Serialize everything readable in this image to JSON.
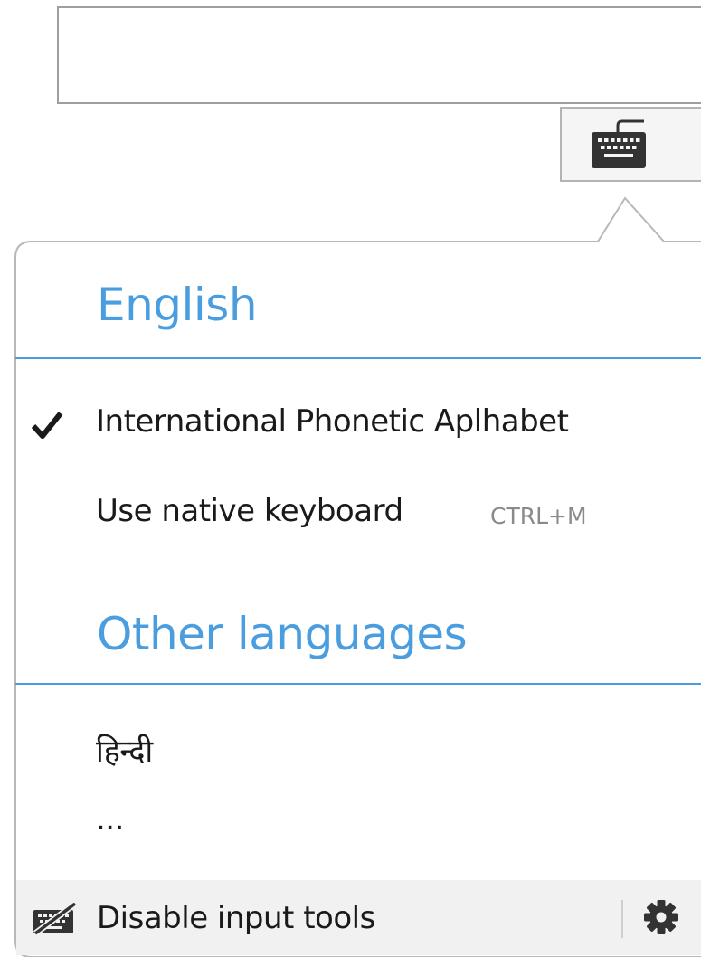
{
  "input": {
    "value": "",
    "placeholder": ""
  },
  "toolbar": {
    "keyboard_icon": "keyboard-icon"
  },
  "menu": {
    "current_language": {
      "heading": "English",
      "items": [
        {
          "label": "International Phonetic Aplhabet",
          "checked": true,
          "icon": "checkmark-icon"
        },
        {
          "label": "Use native keyboard",
          "shortcut": "CTRL+M"
        }
      ]
    },
    "other_languages": {
      "heading": "Other languages",
      "items": [
        {
          "label": "हिन्दी"
        },
        {
          "label": "..."
        }
      ]
    },
    "footer": {
      "disable_label": "Disable input tools",
      "disable_icon": "keyboard-disabled-icon",
      "settings_icon": "gear-icon"
    }
  },
  "colors": {
    "accent": "#4a9ee0",
    "text": "#1a1a1a",
    "muted": "#8a8a8a",
    "footer_bg": "#f1f1f1",
    "border": "#b3b3b3"
  }
}
